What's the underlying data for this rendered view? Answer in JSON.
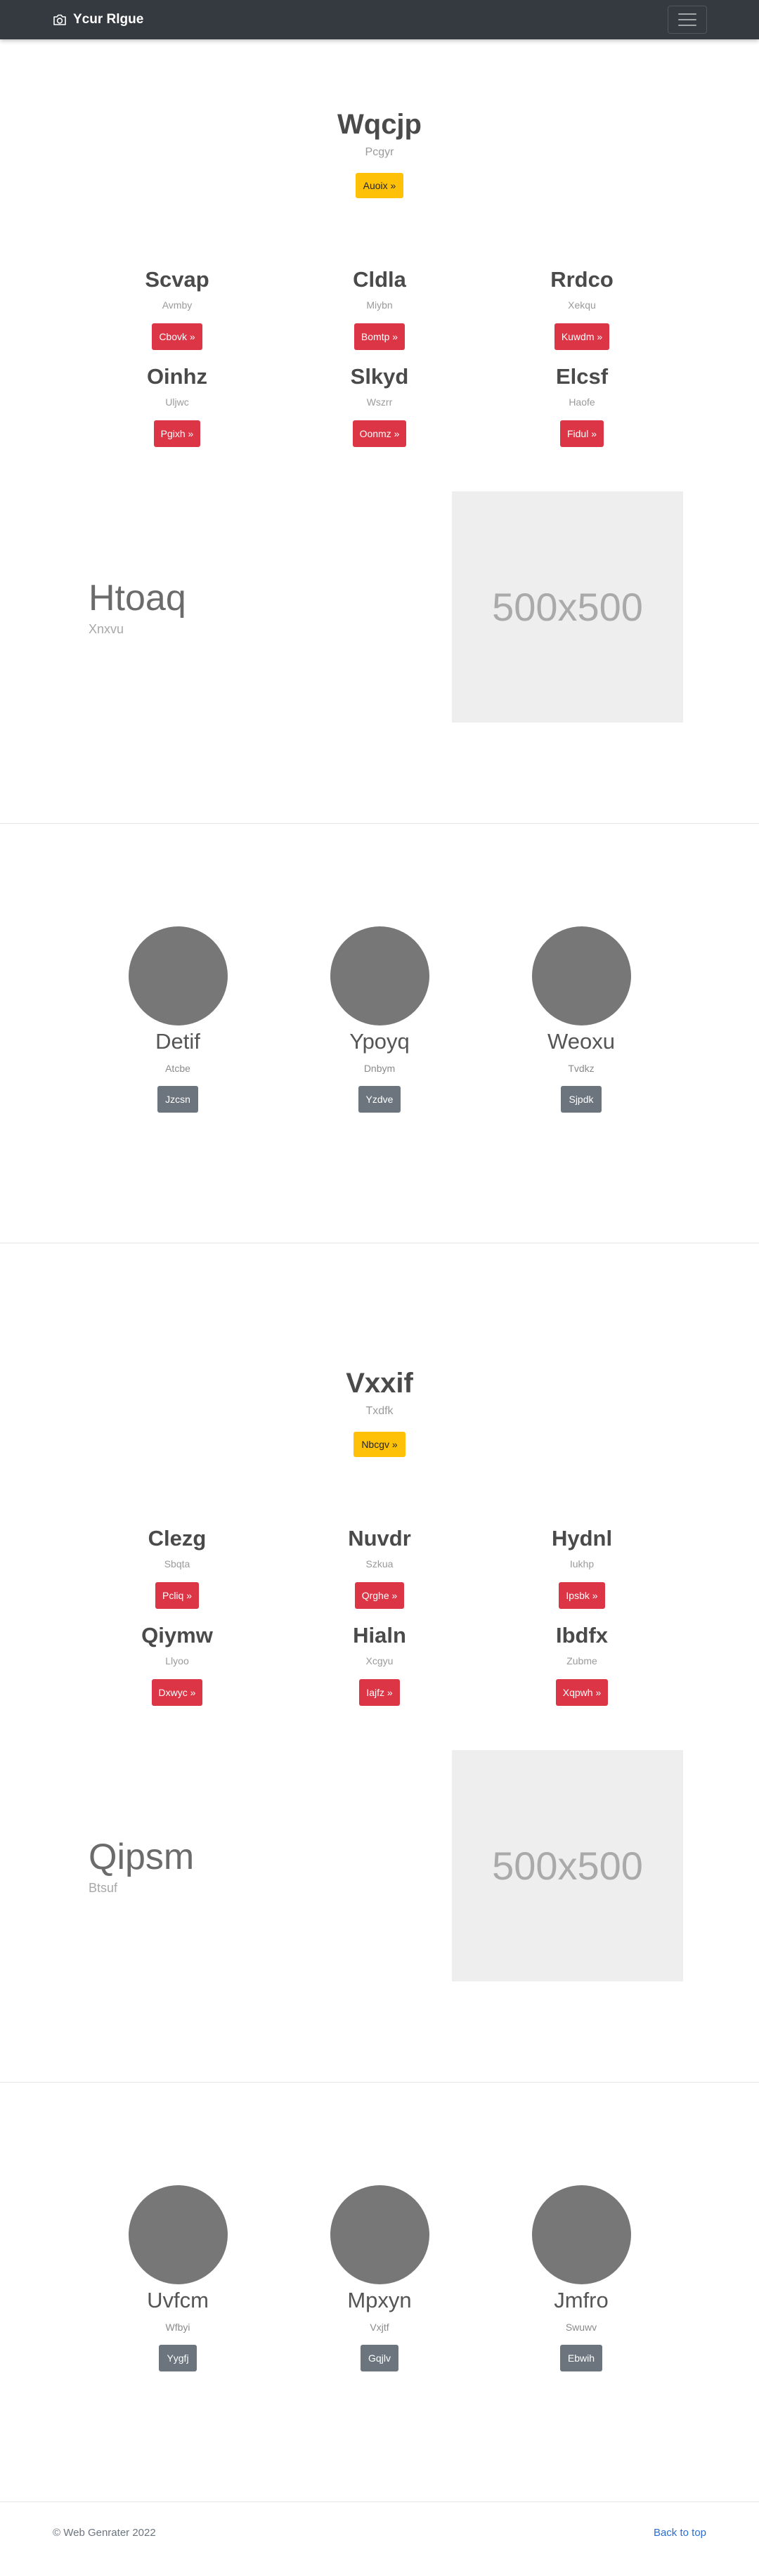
{
  "navbar": {
    "brand": "Ycur Rlgue"
  },
  "block1": {
    "hero": {
      "title": "Wqcjp",
      "subtitle": "Pcgyr",
      "button": "Auoix »"
    },
    "cards": [
      {
        "title": "Scvap",
        "subtitle": "Avmby",
        "button": "Cbovk »"
      },
      {
        "title": "Cldla",
        "subtitle": "Miybn",
        "button": "Bomtp »"
      },
      {
        "title": "Rrdco",
        "subtitle": "Xekqu",
        "button": "Kuwdm »"
      },
      {
        "title": "Oinhz",
        "subtitle": "Uljwc",
        "button": "Pgixh »"
      },
      {
        "title": "Slkyd",
        "subtitle": "Wszrr",
        "button": "Oonmz »"
      },
      {
        "title": "Elcsf",
        "subtitle": "Haofe",
        "button": "Fidul »"
      }
    ],
    "feature": {
      "title": "Htoaq",
      "subtitle": "Xnxvu",
      "image_label": "500x500"
    },
    "team": [
      {
        "name": "Detif",
        "role": "Atcbe",
        "button": "Jzcsn"
      },
      {
        "name": "Ypoyq",
        "role": "Dnbym",
        "button": "Yzdve"
      },
      {
        "name": "Weoxu",
        "role": "Tvdkz",
        "button": "Sjpdk"
      }
    ]
  },
  "block2": {
    "hero": {
      "title": "Vxxif",
      "subtitle": "Txdfk",
      "button": "Nbcgv »"
    },
    "cards": [
      {
        "title": "Clezg",
        "subtitle": "Sbqta",
        "button": "Pcliq »"
      },
      {
        "title": "Nuvdr",
        "subtitle": "Szkua",
        "button": "Qrghe »"
      },
      {
        "title": "Hydnl",
        "subtitle": "Iukhp",
        "button": "Ipsbk »"
      },
      {
        "title": "Qiymw",
        "subtitle": "Llyoo",
        "button": "Dxwyc »"
      },
      {
        "title": "Hialn",
        "subtitle": "Xcgyu",
        "button": "Iajfz »"
      },
      {
        "title": "Ibdfx",
        "subtitle": "Zubme",
        "button": "Xqpwh »"
      }
    ],
    "feature": {
      "title": "Qipsm",
      "subtitle": "Btsuf",
      "image_label": "500x500"
    },
    "team": [
      {
        "name": "Uvfcm",
        "role": "Wfbyi",
        "button": "Yygfj"
      },
      {
        "name": "Mpxyn",
        "role": "Vxjtf",
        "button": "Gqjlv"
      },
      {
        "name": "Jmfro",
        "role": "Swuwv",
        "button": "Ebwih"
      }
    ]
  },
  "footer": {
    "copyright": "© Web Genrater 2022",
    "back_to_top": "Back to top"
  },
  "colors": {
    "navbar": "#343a40",
    "warning": "#ffc107",
    "danger": "#dc3545",
    "secondary": "#6c757d",
    "avatar": "#777777",
    "placeholder": "#eeeeee",
    "link": "#2a6ed4"
  }
}
